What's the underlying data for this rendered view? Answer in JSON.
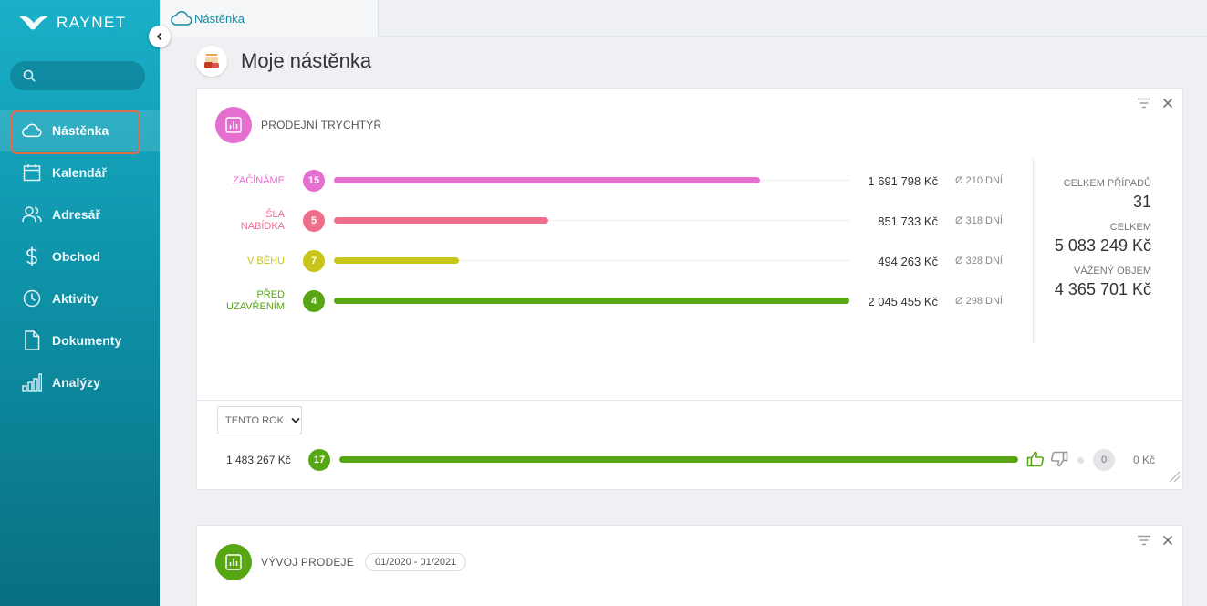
{
  "app": {
    "brand": "RAYNET"
  },
  "search": {
    "placeholder": ""
  },
  "sidebar": {
    "items": [
      {
        "label": "Nástěnka",
        "icon": "cloud-icon",
        "active": true
      },
      {
        "label": "Kalendář",
        "icon": "calendar-icon"
      },
      {
        "label": "Adresář",
        "icon": "contacts-icon"
      },
      {
        "label": "Obchod",
        "icon": "dollar-icon"
      },
      {
        "label": "Aktivity",
        "icon": "clock-icon"
      },
      {
        "label": "Dokumenty",
        "icon": "document-icon"
      },
      {
        "label": "Analýzy",
        "icon": "bar-chart-icon"
      }
    ]
  },
  "breadcrumb": {
    "tab_label": "Nástěnka"
  },
  "header": {
    "title": "Moje nástěnka"
  },
  "funnel": {
    "title": "PRODEJNÍ TRYCHTÝŘ",
    "accent": "#e56fcf",
    "stages": [
      {
        "label1": "ZAČÍNÁME",
        "label2": "",
        "count": "15",
        "amount": "1 691 798 Kč",
        "days": "Ø 210 DNÍ",
        "color": "#e56fcf",
        "fill": 0.827
      },
      {
        "label1": "ŠLA",
        "label2": "NABÍDKA",
        "count": "5",
        "amount": "851 733 Kč",
        "days": "Ø 318 DNÍ",
        "color": "#ef6e8c",
        "fill": 0.416
      },
      {
        "label1": "V BĚHU",
        "label2": "",
        "count": "7",
        "amount": "494 263 Kč",
        "days": "Ø 328 DNÍ",
        "color": "#c8c41a",
        "fill": 0.242
      },
      {
        "label1": "PŘED",
        "label2": "UZAVŘENÍM",
        "count": "4",
        "amount": "2 045 455 Kč",
        "days": "Ø 298 DNÍ",
        "color": "#58a614",
        "fill": 1.0
      }
    ],
    "stats": {
      "cases_label": "CELKEM PŘÍPADŮ",
      "cases_value": "31",
      "total_label": "CELKEM",
      "total_value": "5 083 249 Kč",
      "weighted_label": "VÁŽENÝ OBJEM",
      "weighted_value": "4 365 701 Kč"
    },
    "period": "TENTO ROK",
    "summary": {
      "amount": "1 483 267 Kč",
      "count": "17",
      "zero_count": "0",
      "zero_amount": "0 Kč"
    }
  },
  "sales": {
    "title": "VÝVOJ PRODEJE",
    "range": "01/2020 - 01/2021",
    "accent": "#58a614"
  }
}
